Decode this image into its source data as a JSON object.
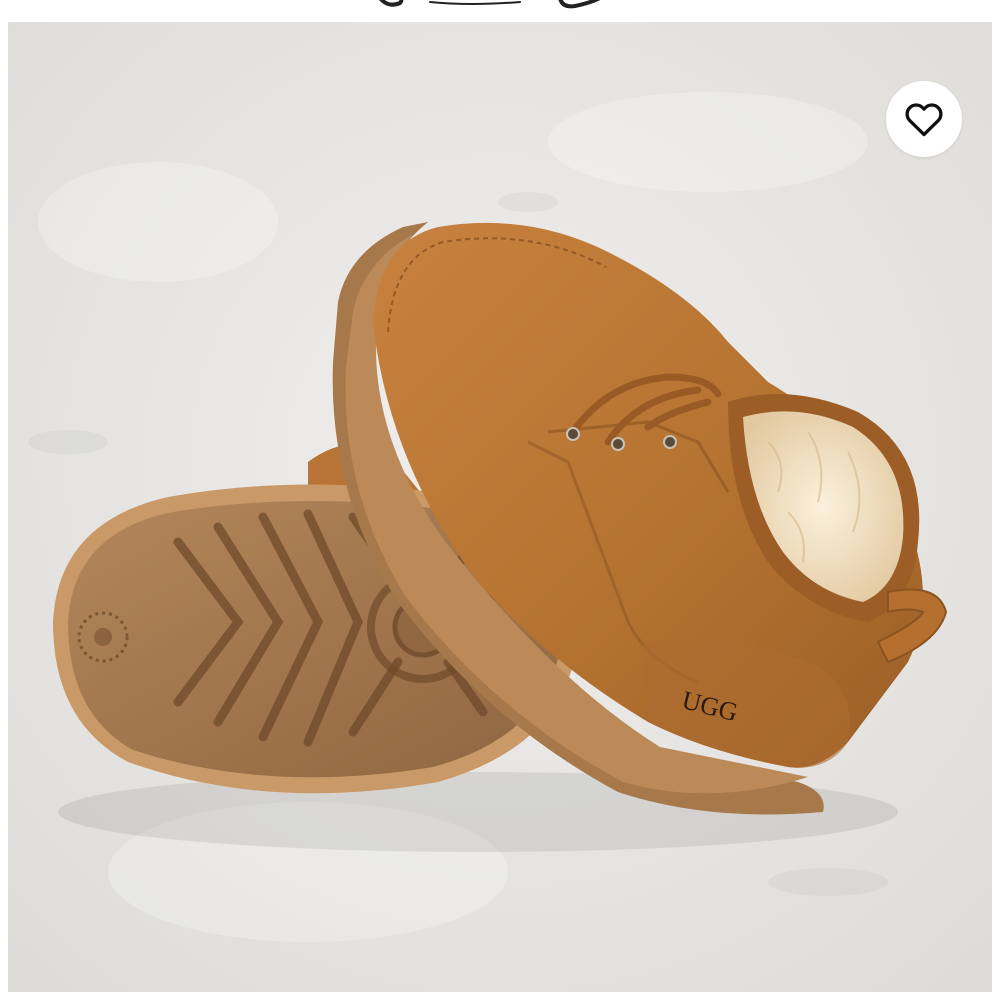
{
  "screen": {
    "background": "#ffffff"
  },
  "header_fragment": {
    "icon": "script-logo-fragment-icon"
  },
  "product_image": {
    "description_icon": "ugg-neumel-boot-image",
    "brand_mark": "UGG",
    "colors": {
      "suede": "#b8763a",
      "suede_dark": "#8f5424",
      "sole": "#a97948",
      "sole_dark": "#7a5533",
      "shearling": "#f1e2c6",
      "background": "#e9e8e6"
    }
  },
  "favorite_button": {
    "icon": "heart-outline-icon",
    "color": "#111111"
  }
}
